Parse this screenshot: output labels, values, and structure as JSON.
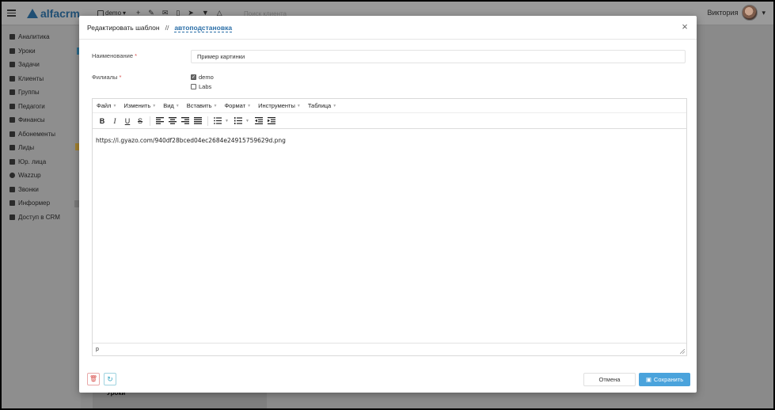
{
  "app": {
    "logo_text": "alfacrm",
    "branch": "demo",
    "search_placeholder": "Поиск клиента",
    "user_name": "Виктория"
  },
  "sidebar": {
    "items": [
      {
        "label": "Аналитика",
        "icon": "chart-icon"
      },
      {
        "label": "Уроки",
        "icon": "calendar-icon"
      },
      {
        "label": "Задачи",
        "icon": "tasks-icon"
      },
      {
        "label": "Клиенты",
        "icon": "user-icon"
      },
      {
        "label": "Группы",
        "icon": "users-icon"
      },
      {
        "label": "Педагоги",
        "icon": "graduation-cap-icon"
      },
      {
        "label": "Финансы",
        "icon": "money-icon"
      },
      {
        "label": "Абонементы",
        "icon": "tag-icon"
      },
      {
        "label": "Лиды",
        "icon": "user-plus-icon"
      },
      {
        "label": "Юр. лица",
        "icon": "briefcase-icon"
      },
      {
        "label": "Wazzup",
        "icon": "whatsapp-icon"
      },
      {
        "label": "Звонки",
        "icon": "phone-icon"
      },
      {
        "label": "Информер",
        "icon": "bell-icon"
      },
      {
        "label": "Доступ в CRM",
        "icon": "lock-icon"
      }
    ]
  },
  "background": {
    "card_title": "Уроки"
  },
  "modal": {
    "title": "Редактировать шаблон",
    "separator": "//",
    "link": "автоподстановка",
    "close": "×",
    "name_label": "Наименование",
    "required_mark": "*",
    "name_value": "Пример картинки",
    "branches_label": "Филиалы",
    "branches": [
      {
        "label": "demo",
        "checked": true
      },
      {
        "label": "Labs",
        "checked": false
      }
    ],
    "editor": {
      "menus": [
        "Файл",
        "Изменить",
        "Вид",
        "Вставить",
        "Формат",
        "Инструменты",
        "Таблица"
      ],
      "content": "https://i.gyazo.com/940df28bced04ec2684e24915759629d.png",
      "status_path": "p"
    },
    "buttons": {
      "cancel": "Отмена",
      "save": "Сохранить"
    }
  },
  "colors": {
    "accent": "#4aa3dc",
    "link": "#2b6fa8",
    "danger": "#d9534f",
    "info": "#3aa8c4"
  }
}
